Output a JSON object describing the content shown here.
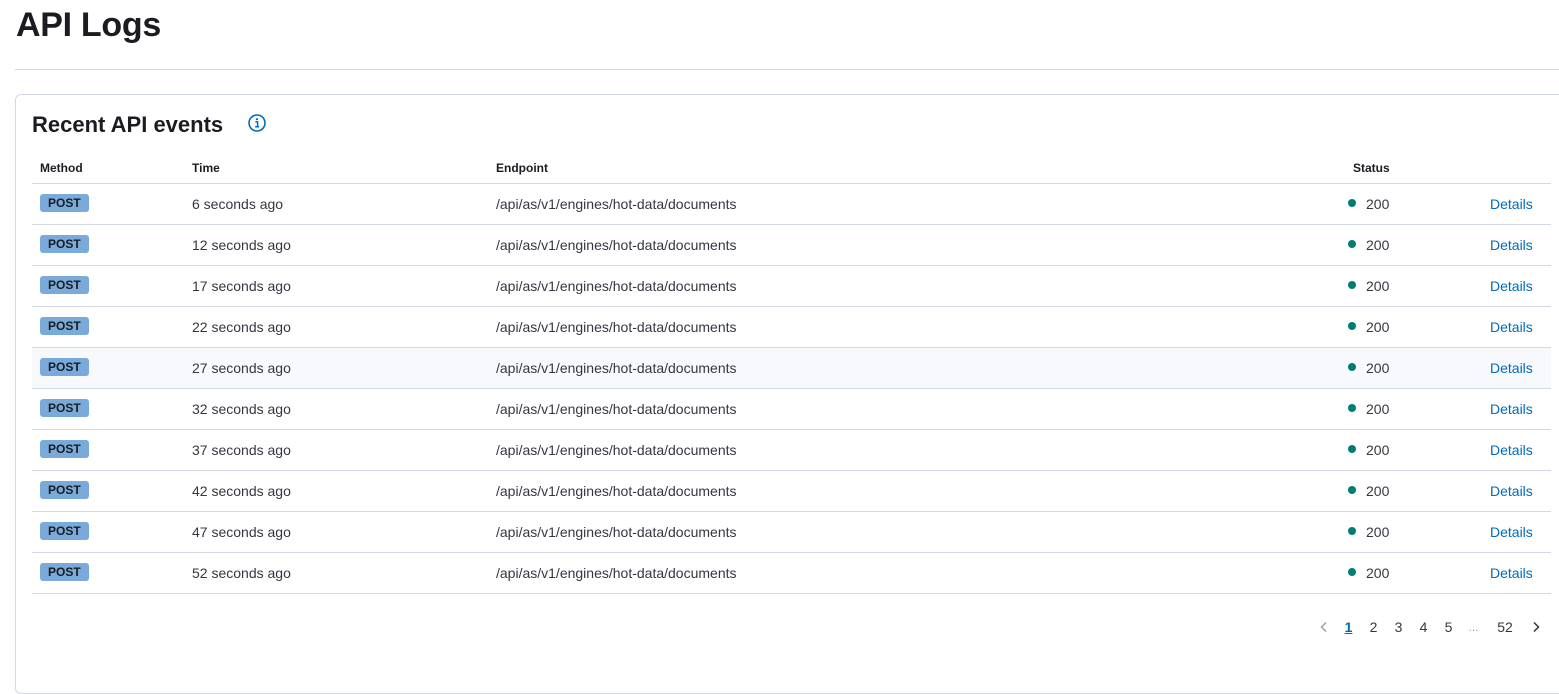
{
  "page": {
    "title": "API Logs"
  },
  "panel": {
    "title": "Recent API events",
    "info_icon": "info-icon"
  },
  "table": {
    "columns": {
      "method": "Method",
      "time": "Time",
      "endpoint": "Endpoint",
      "status": "Status"
    },
    "rows": [
      {
        "method": "POST",
        "time": "6 seconds ago",
        "endpoint": "/api/as/v1/engines/hot-data/documents",
        "status": "200",
        "action": "Details"
      },
      {
        "method": "POST",
        "time": "12 seconds ago",
        "endpoint": "/api/as/v1/engines/hot-data/documents",
        "status": "200",
        "action": "Details"
      },
      {
        "method": "POST",
        "time": "17 seconds ago",
        "endpoint": "/api/as/v1/engines/hot-data/documents",
        "status": "200",
        "action": "Details"
      },
      {
        "method": "POST",
        "time": "22 seconds ago",
        "endpoint": "/api/as/v1/engines/hot-data/documents",
        "status": "200",
        "action": "Details"
      },
      {
        "method": "POST",
        "time": "27 seconds ago",
        "endpoint": "/api/as/v1/engines/hot-data/documents",
        "status": "200",
        "action": "Details"
      },
      {
        "method": "POST",
        "time": "32 seconds ago",
        "endpoint": "/api/as/v1/engines/hot-data/documents",
        "status": "200",
        "action": "Details"
      },
      {
        "method": "POST",
        "time": "37 seconds ago",
        "endpoint": "/api/as/v1/engines/hot-data/documents",
        "status": "200",
        "action": "Details"
      },
      {
        "method": "POST",
        "time": "42 seconds ago",
        "endpoint": "/api/as/v1/engines/hot-data/documents",
        "status": "200",
        "action": "Details"
      },
      {
        "method": "POST",
        "time": "47 seconds ago",
        "endpoint": "/api/as/v1/engines/hot-data/documents",
        "status": "200",
        "action": "Details"
      },
      {
        "method": "POST",
        "time": "52 seconds ago",
        "endpoint": "/api/as/v1/engines/hot-data/documents",
        "status": "200",
        "action": "Details"
      }
    ]
  },
  "pagination": {
    "pages": [
      "1",
      "2",
      "3",
      "4",
      "5"
    ],
    "ellipsis": "...",
    "last": "52",
    "current": "1",
    "prev_icon": "chevron-left-icon",
    "next_icon": "chevron-right-icon"
  },
  "colors": {
    "method_badge": "#79aad9",
    "status_success": "#017d73",
    "link": "#006bb8",
    "border": "#d3dae6"
  }
}
